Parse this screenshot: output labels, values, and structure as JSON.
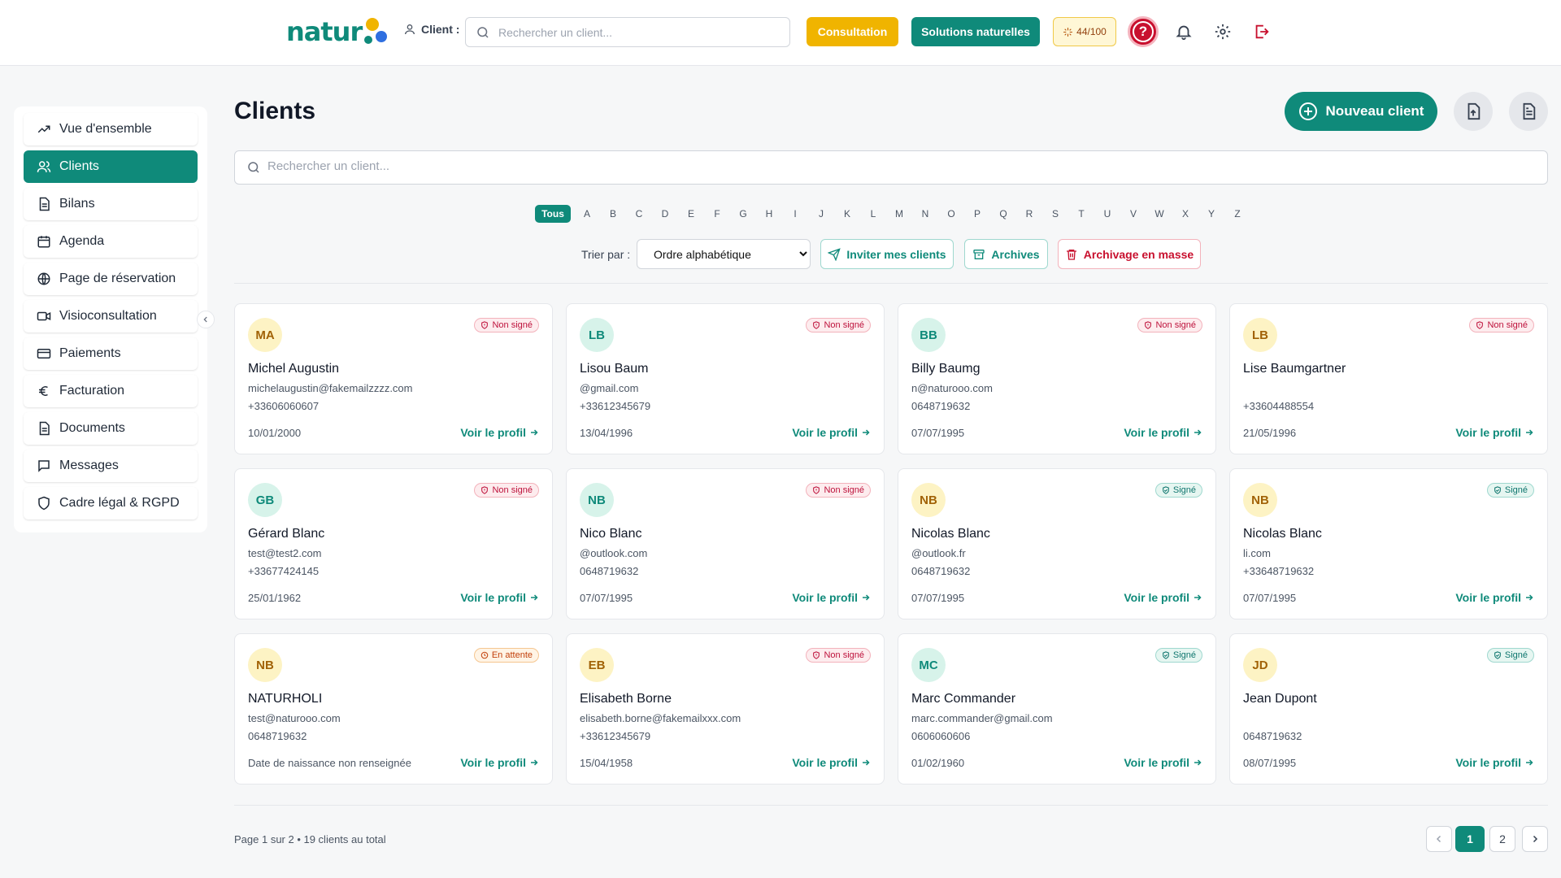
{
  "brand": {
    "name": "natur",
    "colors": {
      "primary": "#0f8a7a",
      "accent": "#f0b400",
      "danger": "#c8102e"
    }
  },
  "header": {
    "client_label": "Client :",
    "search_placeholder": "Rechercher un client...",
    "consultation_label": "Consultation",
    "solutions_label": "Solutions naturelles",
    "score": "44/100",
    "help_glyph": "?",
    "icons": [
      "help-icon",
      "bell-icon",
      "gear-icon",
      "logout-icon"
    ]
  },
  "sidebar": {
    "items": [
      {
        "label": "Vue d'ensemble",
        "icon": "trend-icon",
        "active": false
      },
      {
        "label": "Clients",
        "icon": "users-icon",
        "active": true
      },
      {
        "label": "Bilans",
        "icon": "doc-icon",
        "active": false
      },
      {
        "label": "Agenda",
        "icon": "calendar-icon",
        "active": false
      },
      {
        "label": "Page de réservation",
        "icon": "globe-icon",
        "active": false
      },
      {
        "label": "Visioconsultation",
        "icon": "video-icon",
        "active": false
      },
      {
        "label": "Paiements",
        "icon": "card-icon",
        "active": false
      },
      {
        "label": "Facturation",
        "icon": "euro-icon",
        "active": false
      },
      {
        "label": "Documents",
        "icon": "doc-icon",
        "active": false
      },
      {
        "label": "Messages",
        "icon": "message-icon",
        "active": false
      },
      {
        "label": "Cadre légal & RGPD",
        "icon": "shield-icon",
        "active": false
      }
    ]
  },
  "main": {
    "title": "Clients",
    "new_client_label": "Nouveau client",
    "search_placeholder": "Rechercher un client...",
    "letters": [
      "Tous",
      "A",
      "B",
      "C",
      "D",
      "E",
      "F",
      "G",
      "H",
      "I",
      "J",
      "K",
      "L",
      "M",
      "N",
      "O",
      "P",
      "Q",
      "R",
      "S",
      "T",
      "U",
      "V",
      "W",
      "X",
      "Y",
      "Z"
    ],
    "sort_label": "Trier par :",
    "sort_value": "Ordre alphabétique",
    "invite_label": "Inviter mes clients",
    "archives_label": "Archives",
    "mass_archive_label": "Archivage en masse"
  },
  "clients": [
    {
      "initials": "MA",
      "avatar": "yellow",
      "status": "Non signé",
      "status_kind": "ns",
      "name": "Michel Augustin",
      "email": "michelaugustin@fakemailzzzz.com",
      "phone": "+33606060607",
      "date": "10/01/2000"
    },
    {
      "initials": "LB",
      "avatar": "green",
      "status": "Non signé",
      "status_kind": "ns",
      "name": "Lisou Baum",
      "email": "@gmail.com",
      "phone": "+33612345679",
      "date": "13/04/1996"
    },
    {
      "initials": "BB",
      "avatar": "green",
      "status": "Non signé",
      "status_kind": "ns",
      "name": "Billy Baumg",
      "email": "n@naturooo.com",
      "phone": "0648719632",
      "date": "07/07/1995"
    },
    {
      "initials": "LB",
      "avatar": "yellow",
      "status": "Non signé",
      "status_kind": "ns",
      "name": "Lise Baumgartner",
      "email": "",
      "phone": "+33604488554",
      "date": "21/05/1996"
    },
    {
      "initials": "GB",
      "avatar": "green",
      "status": "Non signé",
      "status_kind": "ns",
      "name": "Gérard Blanc",
      "email": "test@test2.com",
      "phone": "+33677424145",
      "date": "25/01/1962"
    },
    {
      "initials": "NB",
      "avatar": "green",
      "status": "Non signé",
      "status_kind": "ns",
      "name": "Nico Blanc",
      "email": "@outlook.com",
      "phone": "0648719632",
      "date": "07/07/1995"
    },
    {
      "initials": "NB",
      "avatar": "yellow",
      "status": "Signé",
      "status_kind": "sg",
      "name": "Nicolas Blanc",
      "email": "@outlook.fr",
      "phone": "0648719632",
      "date": "07/07/1995"
    },
    {
      "initials": "NB",
      "avatar": "yellow",
      "status": "Signé",
      "status_kind": "sg",
      "name": "Nicolas Blanc",
      "email": "li.com",
      "phone": "+33648719632",
      "date": "07/07/1995"
    },
    {
      "initials": "NB",
      "avatar": "yellow",
      "status": "En attente",
      "status_kind": "wt",
      "name": "NATURHOLI",
      "email": "test@naturooo.com",
      "phone": "0648719632",
      "date": "Date de naissance non renseignée"
    },
    {
      "initials": "EB",
      "avatar": "yellow",
      "status": "Non signé",
      "status_kind": "ns",
      "name": "Elisabeth Borne",
      "email": "elisabeth.borne@fakemailxxx.com",
      "phone": "+33612345679",
      "date": "15/04/1958"
    },
    {
      "initials": "MC",
      "avatar": "green",
      "status": "Signé",
      "status_kind": "sg",
      "name": "Marc Commander",
      "email": "marc.commander@gmail.com",
      "phone": "0606060606",
      "date": "01/02/1960"
    },
    {
      "initials": "JD",
      "avatar": "yellow",
      "status": "Signé",
      "status_kind": "sg",
      "name": "Jean Dupont",
      "email": "",
      "phone": "0648719632",
      "date": "08/07/1995"
    }
  ],
  "card_link_label": "Voir le profil",
  "footer": {
    "summary": "Page 1 sur 2 • 19 clients au total",
    "pages": [
      "1",
      "2"
    ],
    "current_page": "1"
  }
}
